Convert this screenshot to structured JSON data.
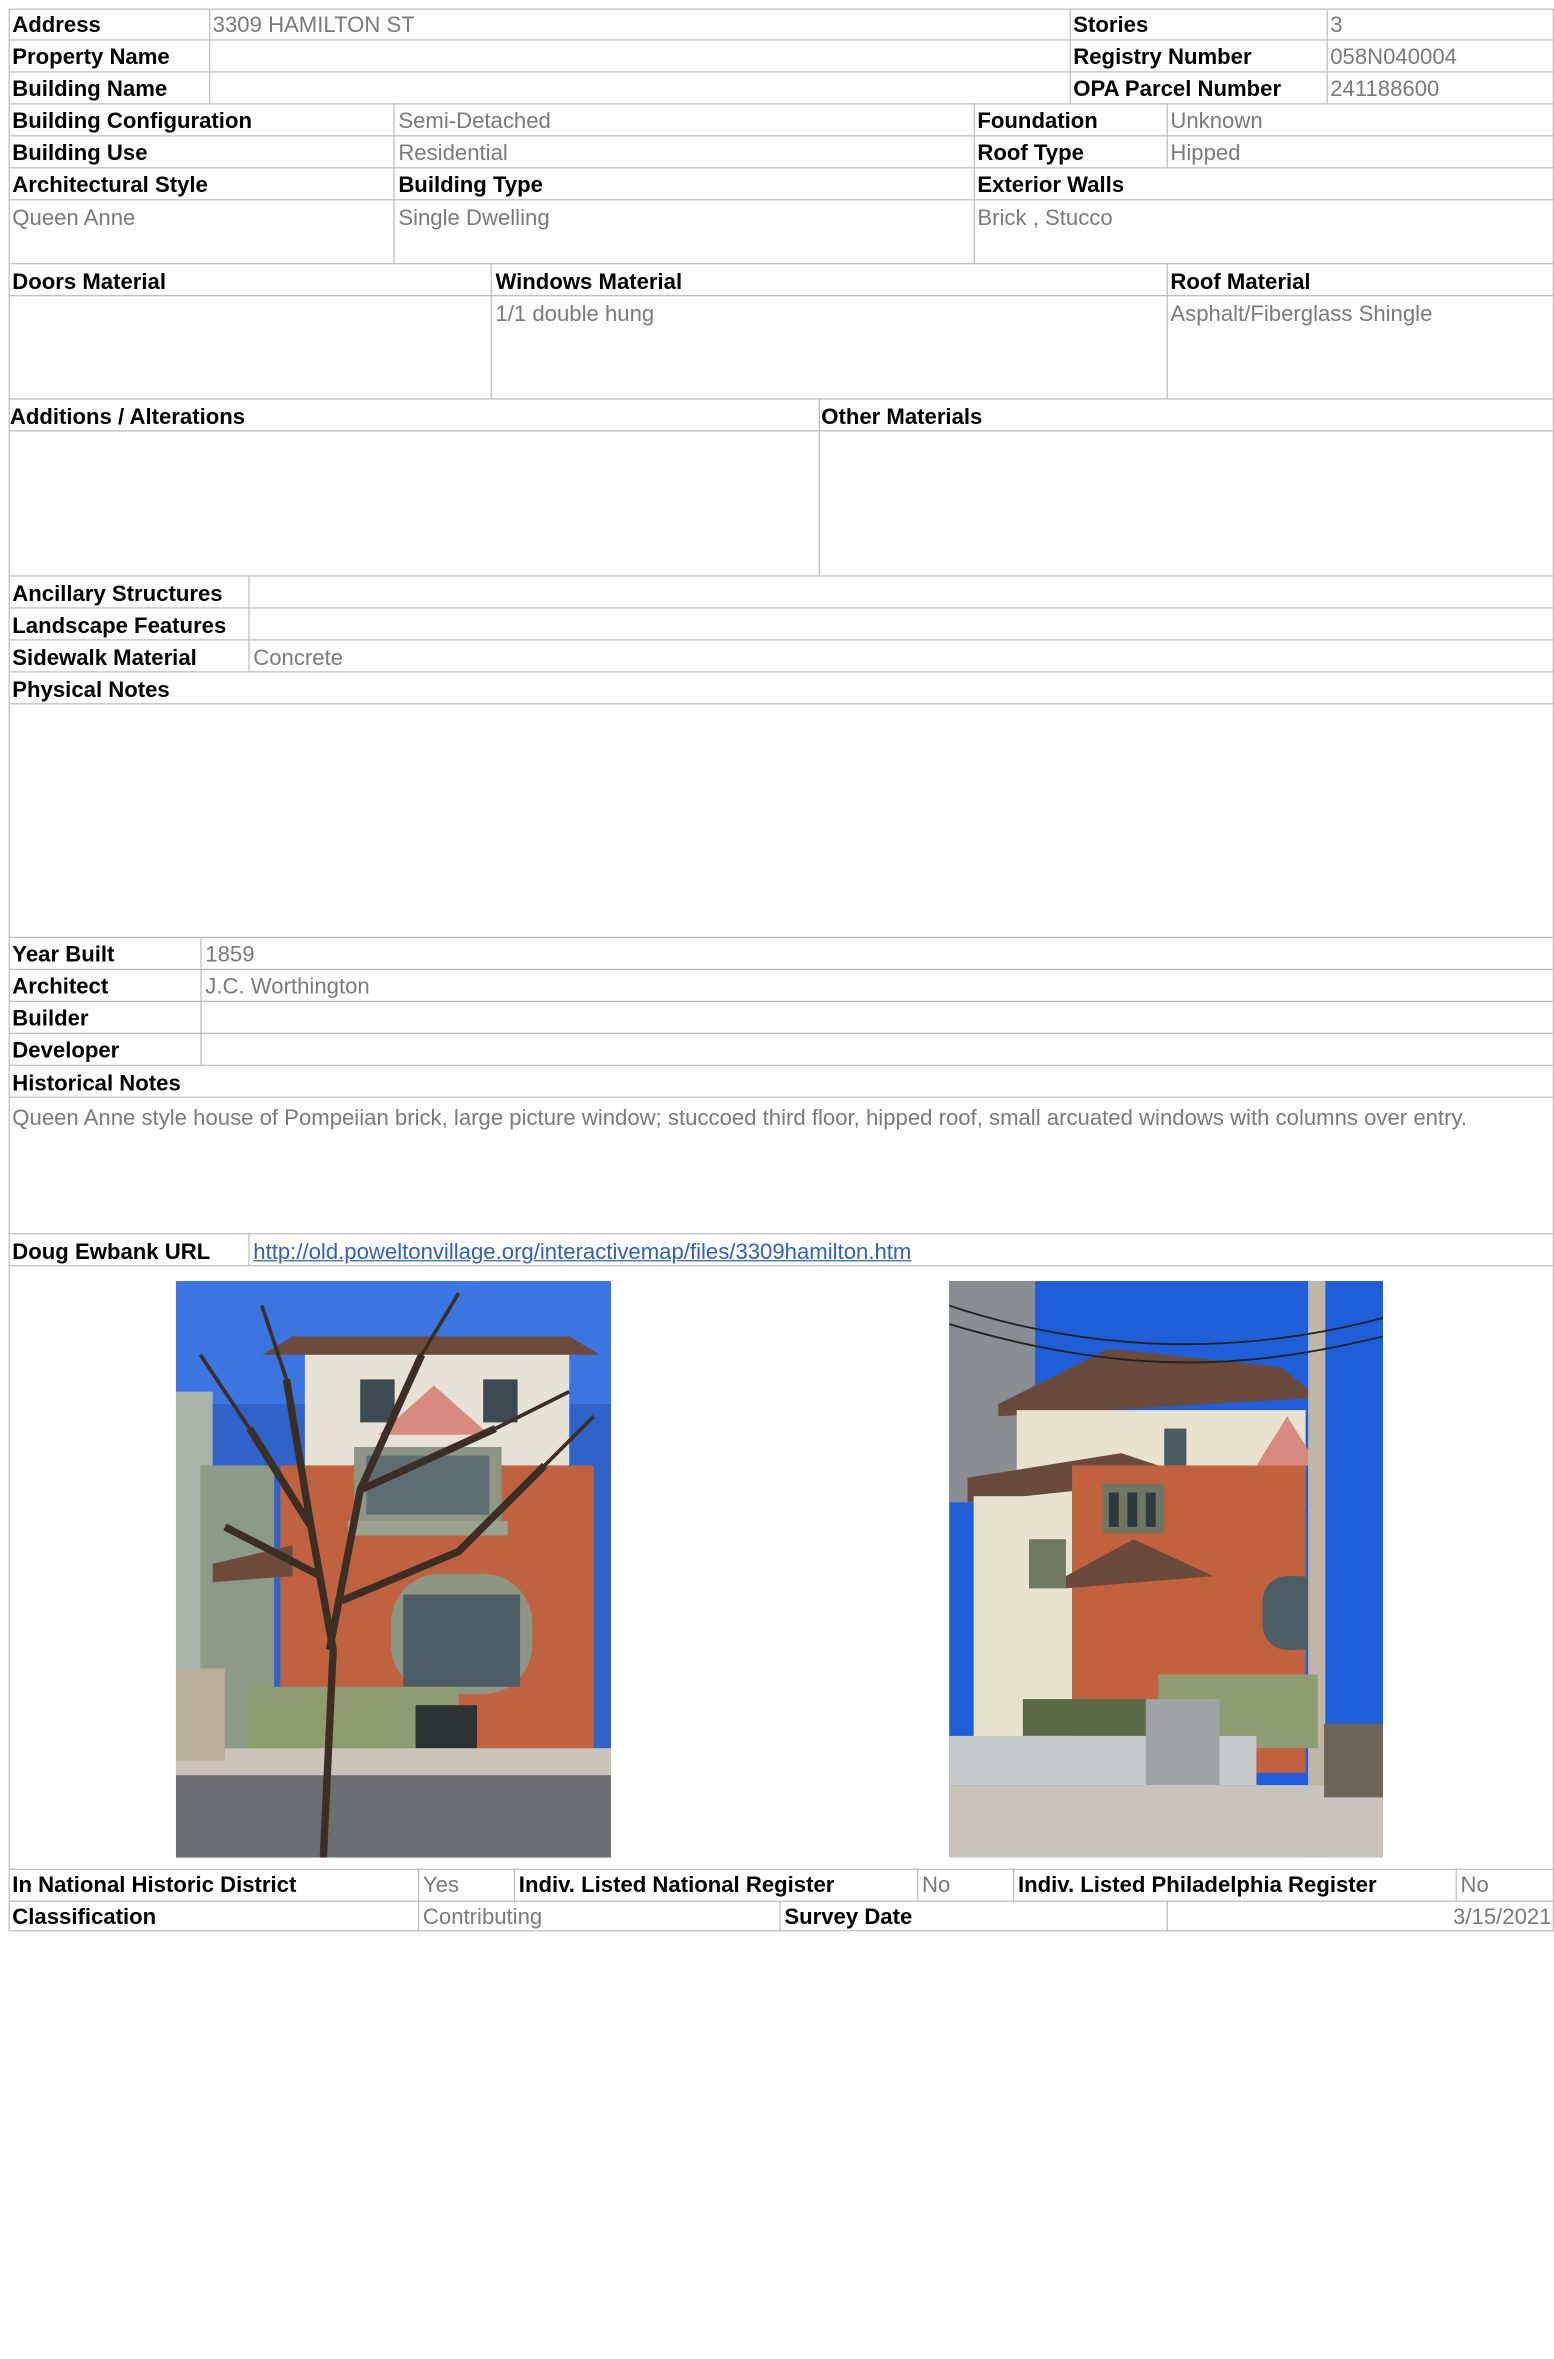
{
  "top": {
    "address_label": "Address",
    "address": "3309 HAMILTON ST",
    "stories_label": "Stories",
    "stories": "3",
    "property_name_label": "Property Name",
    "property_name": "",
    "registry_label": "Registry Number",
    "registry": "058N040004",
    "building_name_label": "Building Name",
    "building_name": "",
    "opa_label": "OPA Parcel Number",
    "opa": "241188600"
  },
  "config": {
    "configuration_label": "Building Configuration",
    "configuration": "Semi-Detached",
    "foundation_label": "Foundation",
    "foundation": "Unknown",
    "use_label": "Building Use",
    "use": "Residential",
    "roof_type_label": "Roof Type",
    "roof_type": "Hipped",
    "style_label": "Architectural Style",
    "style": "Queen Anne",
    "type_label": "Building Type",
    "type": "Single Dwelling",
    "walls_label": "Exterior Walls",
    "walls": "Brick , Stucco"
  },
  "materials": {
    "doors_label": "Doors Material",
    "doors": "",
    "windows_label": "Windows Material",
    "windows": "1/1 double hung",
    "roof_label": "Roof Material",
    "roof": "Asphalt/Fiberglass Shingle",
    "additions_label": "Additions / Alterations",
    "additions": "",
    "other_label": "Other Materials",
    "other": ""
  },
  "site": {
    "ancillary_label": "Ancillary Structures",
    "ancillary": "",
    "landscape_label": "Landscape Features",
    "landscape": "",
    "sidewalk_label": "Sidewalk Material",
    "sidewalk": "Concrete",
    "physical_notes_label": "Physical Notes",
    "physical_notes": ""
  },
  "history": {
    "year_label": "Year Built",
    "year": "1859",
    "architect_label": "Architect",
    "architect": "J.C. Worthington",
    "builder_label": "Builder",
    "builder": "",
    "developer_label": "Developer",
    "developer": "",
    "notes_label": "Historical Notes",
    "notes": "Queen Anne style house of Pompeiian brick, large picture window; stuccoed third floor, hipped roof, small arcuated windows with columns over entry.",
    "url_label": "Doug Ewbank URL",
    "url": "http://old.poweltonvillage.org/interactivemap/files/3309hamilton.htm"
  },
  "status": {
    "district_label": "In National Historic District",
    "district": "Yes",
    "national_label": "Indiv. Listed National Register",
    "national": "No",
    "philadelphia_label": "Indiv. Listed Philadelphia Register",
    "philadelphia": "No",
    "classification_label": "Classification",
    "classification": "Contributing",
    "survey_label": "Survey Date",
    "survey": "3/15/2021"
  },
  "colors": {
    "border": "#bdbdbd",
    "label": "#000000",
    "value": "#7a7a7a",
    "link": "#2f5fbf"
  },
  "photos": [
    "house-front-photo",
    "house-angle-photo"
  ]
}
